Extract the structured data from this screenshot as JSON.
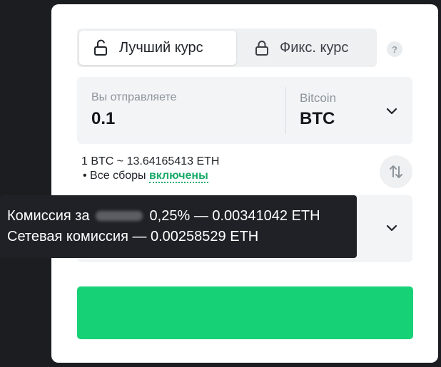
{
  "tabs": {
    "best_rate": "Лучший курс",
    "fixed_rate": "Фикс. курс",
    "help": "?"
  },
  "send": {
    "label": "Вы отправляете",
    "amount": "0.1",
    "currency_name": "Bitcoin",
    "currency_code": "BTC"
  },
  "rate": {
    "text": "1 BTC ~ 13.64165413 ETH",
    "fees_prefix": "• Все сборы ",
    "fees_link": "включены"
  },
  "tooltip": {
    "line1_prefix": "Комиссия за",
    "line1_suffix": "0,25% — 0.00341042 ETH",
    "line2": "Сетевая комиссия — 0.00258529 ETH"
  },
  "colors": {
    "accent": "#17d177",
    "link": "#1aaa6a",
    "background": "#1b1d20"
  }
}
